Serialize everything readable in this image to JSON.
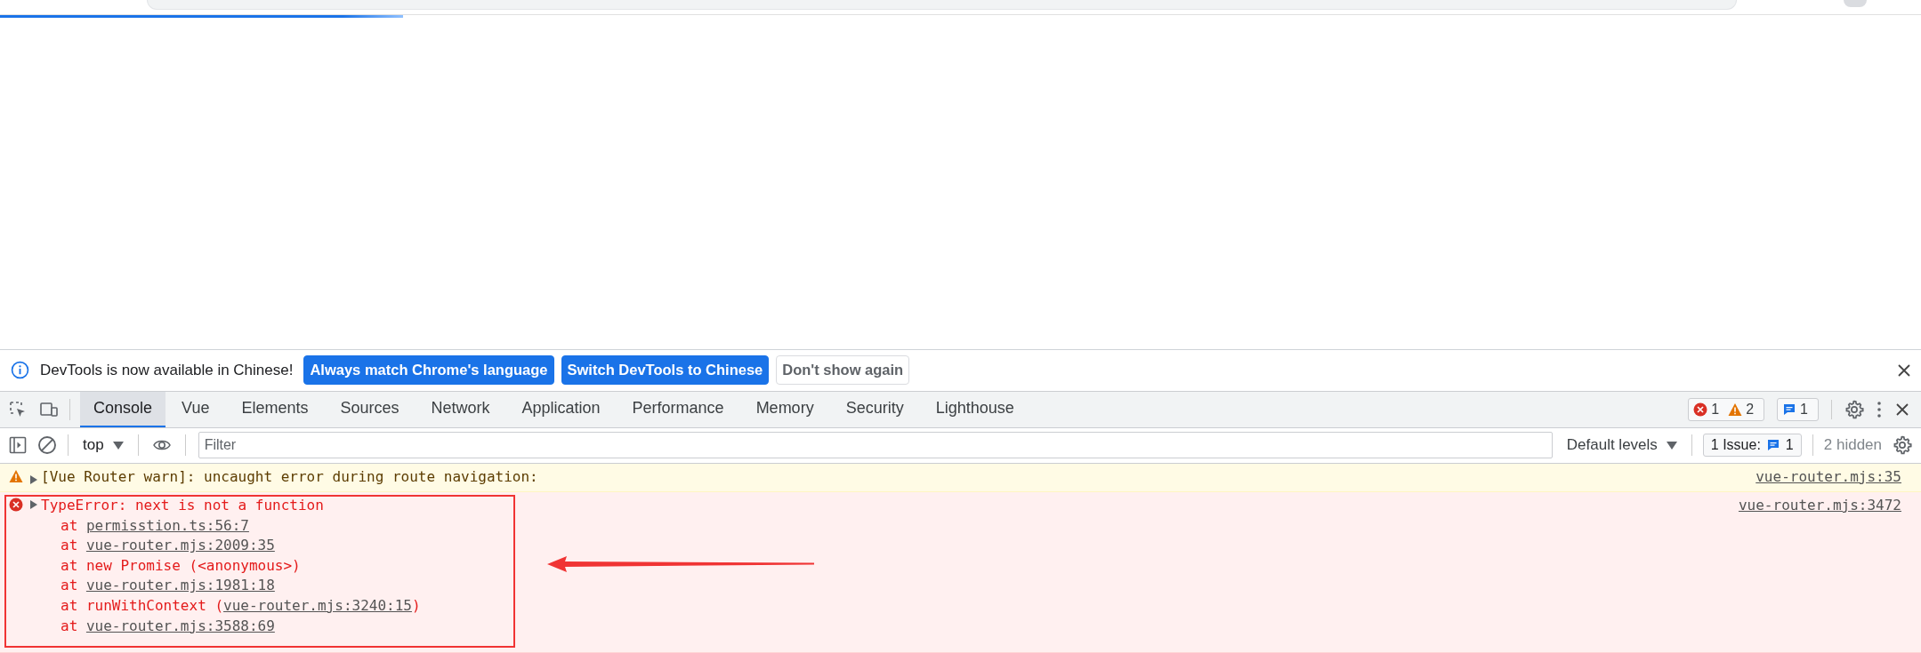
{
  "page_load": {
    "level": 0.21
  },
  "infobar": {
    "message": "DevTools is now available in Chinese!",
    "buttons": [
      {
        "label": "Always match Chrome's language",
        "kind": "primary"
      },
      {
        "label": "Switch DevTools to Chinese",
        "kind": "primary"
      },
      {
        "label": "Don't show again",
        "kind": "secondary"
      }
    ]
  },
  "tabs": [
    {
      "label": "Console",
      "selected": true
    },
    {
      "label": "Vue",
      "selected": false
    },
    {
      "label": "Elements",
      "selected": false
    },
    {
      "label": "Sources",
      "selected": false
    },
    {
      "label": "Network",
      "selected": false
    },
    {
      "label": "Application",
      "selected": false
    },
    {
      "label": "Performance",
      "selected": false
    },
    {
      "label": "Memory",
      "selected": false
    },
    {
      "label": "Security",
      "selected": false
    },
    {
      "label": "Lighthouse",
      "selected": false
    }
  ],
  "counters": {
    "errors": "1",
    "warnings": "2",
    "messages": "1"
  },
  "toolbar": {
    "context": "top",
    "filter_placeholder": "Filter",
    "levels": "Default levels",
    "issues_label": "1 Issue:",
    "issues_count": "1",
    "hidden": "2 hidden"
  },
  "messages": [
    {
      "kind": "warning",
      "expanded": false,
      "text": "[Vue Router warn]: uncaught error during route navigation:",
      "source": "vue-router.mjs:35"
    },
    {
      "kind": "error",
      "expanded": false,
      "text": "TypeError: next is not a function",
      "source": "vue-router.mjs:3472",
      "stack": [
        {
          "prefix": "at ",
          "link": "permisstion.ts:56:7"
        },
        {
          "prefix": "at ",
          "link": "vue-router.mjs:2009:35"
        },
        {
          "prefix": "at new Promise (<anonymous>)"
        },
        {
          "prefix": "at ",
          "link": "vue-router.mjs:1981:18"
        },
        {
          "prefix": "at runWithContext (",
          "link": "vue-router.mjs:3240:15",
          "suffix": ")"
        },
        {
          "prefix": "at ",
          "link": "vue-router.mjs:3588:69"
        }
      ]
    }
  ]
}
